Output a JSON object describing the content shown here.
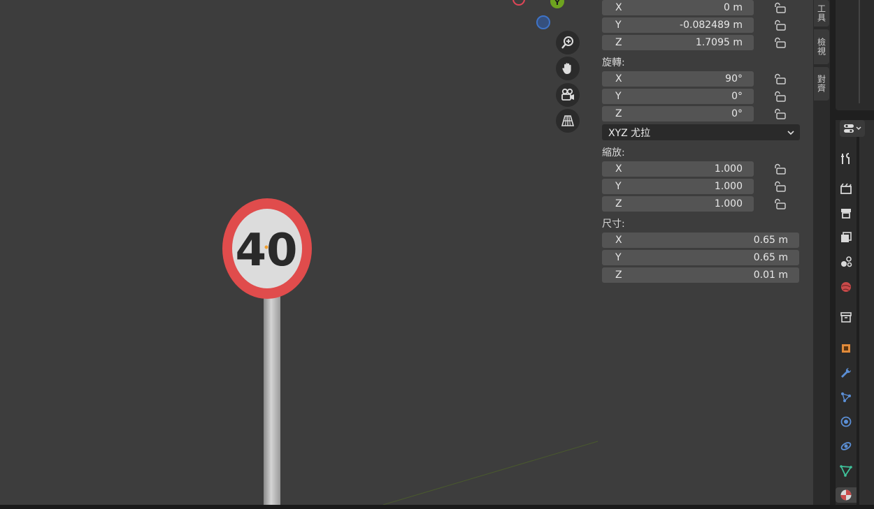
{
  "npanel": {
    "location_rows": [
      {
        "axis": "X",
        "value": "0 m"
      },
      {
        "axis": "Y",
        "value": "-0.082489 m"
      },
      {
        "axis": "Z",
        "value": "1.7095 m"
      }
    ],
    "rotation_label": "旋轉:",
    "rotation_rows": [
      {
        "axis": "X",
        "value": "90°"
      },
      {
        "axis": "Y",
        "value": "0°"
      },
      {
        "axis": "Z",
        "value": "0°"
      }
    ],
    "rotation_mode": "XYZ 尤拉",
    "scale_label": "縮放:",
    "scale_rows": [
      {
        "axis": "X",
        "value": "1.000"
      },
      {
        "axis": "Y",
        "value": "1.000"
      },
      {
        "axis": "Z",
        "value": "1.000"
      }
    ],
    "dimensions_label": "尺寸:",
    "dimensions_rows": [
      {
        "axis": "X",
        "value": "0.65 m"
      },
      {
        "axis": "Y",
        "value": "0.65 m"
      },
      {
        "axis": "Z",
        "value": "0.01 m"
      }
    ]
  },
  "vtabs": [
    "工具",
    "檢視",
    "對齊"
  ],
  "viewport": {
    "sign_text": "40",
    "gizmo_y_label": "Y",
    "nav_buttons": [
      "zoom-icon",
      "hand-pan-icon",
      "camera-view-icon",
      "perspective-grid-icon"
    ]
  },
  "properties_tabs": [
    "tool-icon",
    "render-icon",
    "output-icon",
    "view-layer-icon",
    "scene-icon",
    "world-icon",
    "collection-icon",
    "object-icon",
    "modifier-icon",
    "particles-icon",
    "physics-icon",
    "constraints-icon",
    "data-icon",
    "material-icon"
  ],
  "colors": {
    "viewport_bg": "#3d3d3d",
    "field_bg": "#545454",
    "sign_red": "#e04c4c",
    "gizmo_red": "#e04657",
    "gizmo_green": "#6ea31f",
    "gizmo_blue": "#3e73c7"
  }
}
